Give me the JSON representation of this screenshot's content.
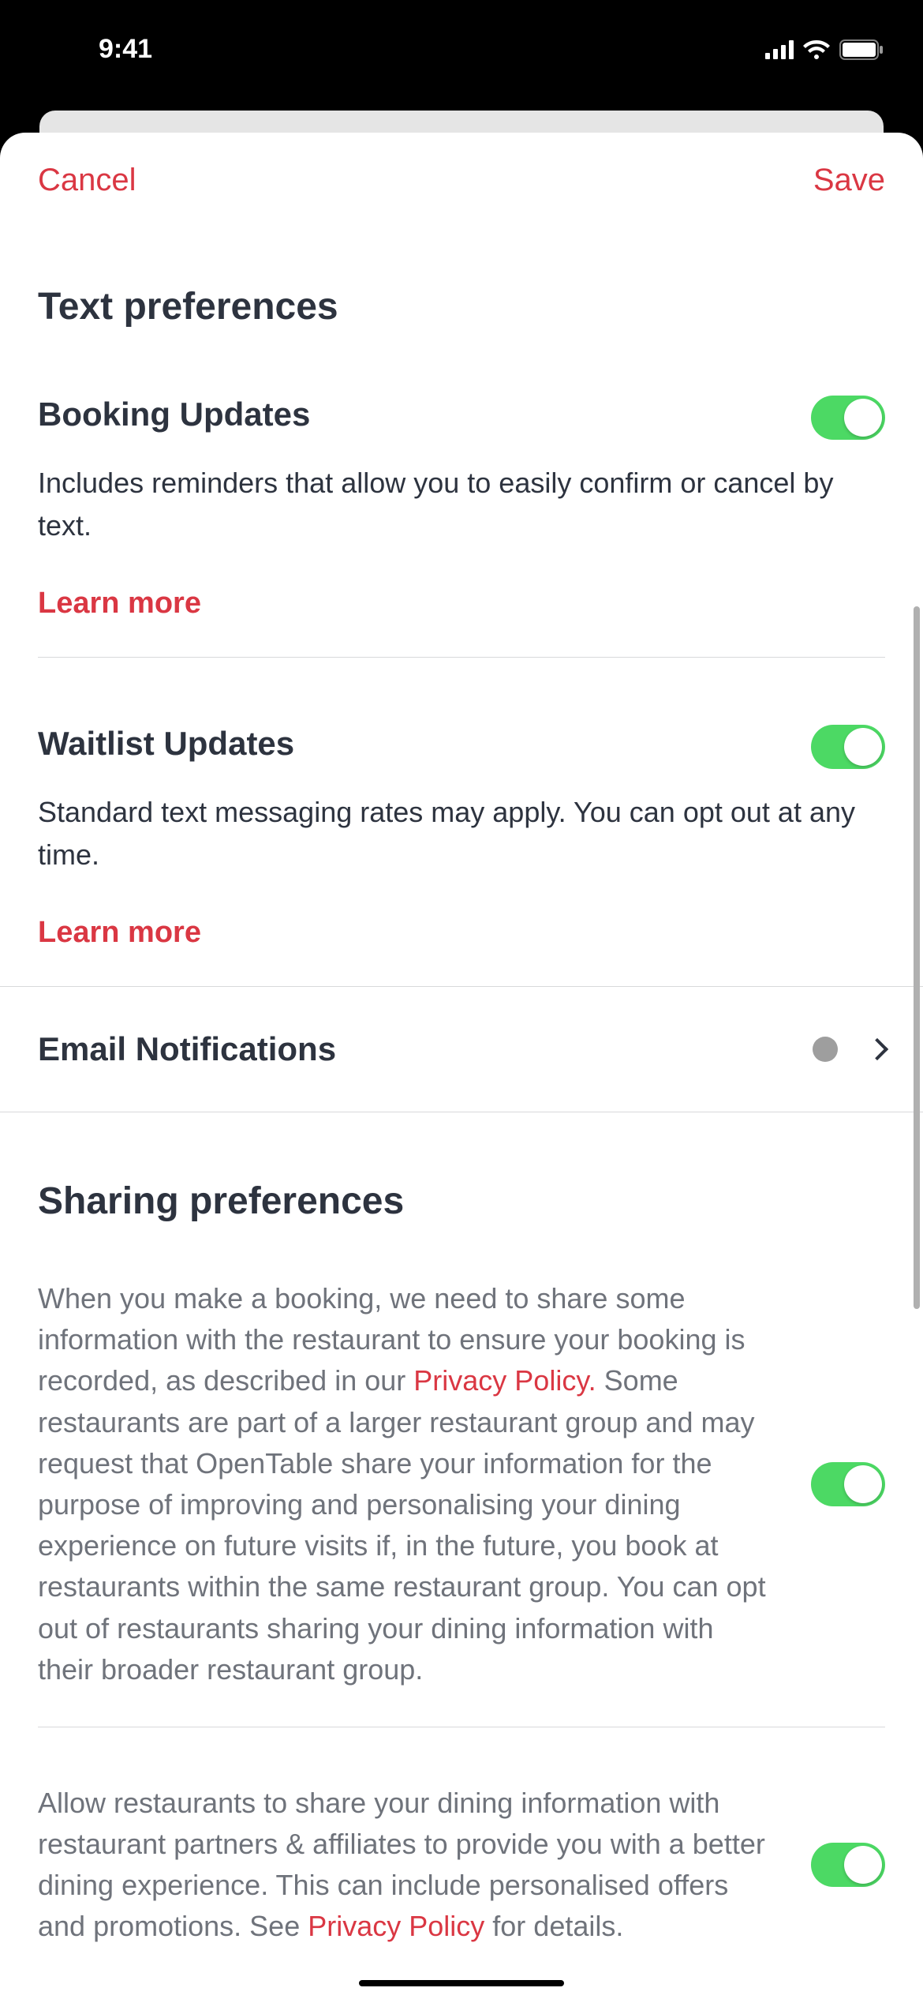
{
  "statusBar": {
    "time": "9:41"
  },
  "header": {
    "cancel": "Cancel",
    "save": "Save"
  },
  "sections": {
    "text_preferences": {
      "title": "Text preferences",
      "booking": {
        "title": "Booking Updates",
        "desc": "Includes reminders that allow you to easily confirm or cancel by text.",
        "learn_more": "Learn more",
        "toggle_on": true
      },
      "waitlist": {
        "title": "Waitlist Updates",
        "desc": "Standard text messaging rates may apply. You can opt out at any time.",
        "learn_more": "Learn more",
        "toggle_on": true
      },
      "email": {
        "title": "Email Notifications"
      }
    },
    "sharing": {
      "title": "Sharing preferences",
      "row1": {
        "text_before": "When you make a booking, we need to share some information with the restaurant to ensure your booking is recorded, as described in our ",
        "privacy_link": "Privacy Policy.",
        "text_after": " Some restaurants are part of a larger restaurant group and may request that OpenTable share your information for the purpose of improving and personalising your dining experience on future visits if, in the future, you book at restaurants within the same restaurant group. You can opt out of restaurants sharing your dining information with their broader restaurant group.",
        "toggle_on": true
      },
      "row2": {
        "text_before": "Allow restaurants to share your dining information with restaurant partners & affiliates to provide you with a better dining experience. This can include personalised offers and promotions. See ",
        "privacy_link": "Privacy Policy",
        "text_after": " for details.",
        "toggle_on": true
      }
    }
  }
}
